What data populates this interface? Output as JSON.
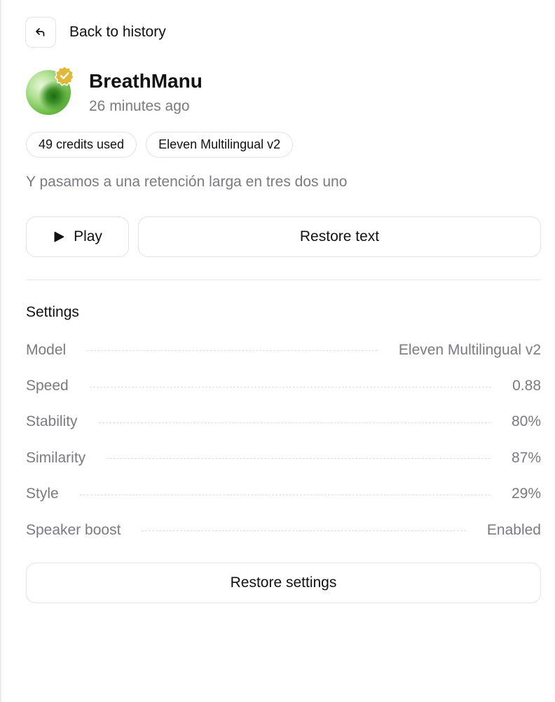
{
  "header": {
    "back_label": "Back to history"
  },
  "voice": {
    "name": "BreathManu",
    "time_ago": "26 minutes ago",
    "verified_badge_color": "#e0b93a",
    "avatar_color": "#6fbf4a"
  },
  "chips": [
    {
      "label": "49 credits used"
    },
    {
      "label": "Eleven Multilingual v2"
    }
  ],
  "prompt_text": "Y pasamos a una retención larga en tres dos uno",
  "actions": {
    "play_label": "Play",
    "play_icon": "play-icon",
    "restore_text_label": "Restore text"
  },
  "settings": {
    "title": "Settings",
    "rows": [
      {
        "label": "Model",
        "value": "Eleven Multilingual v2"
      },
      {
        "label": "Speed",
        "value": "0.88"
      },
      {
        "label": "Stability",
        "value": "80%"
      },
      {
        "label": "Similarity",
        "value": "87%"
      },
      {
        "label": "Style",
        "value": "29%"
      },
      {
        "label": "Speaker boost",
        "value": "Enabled"
      }
    ],
    "restore_label": "Restore settings"
  }
}
